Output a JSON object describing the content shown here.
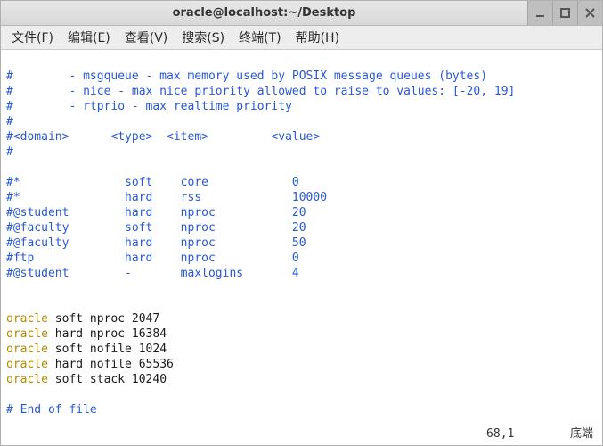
{
  "titlebar": {
    "title": "oracle@localhost:~/Desktop"
  },
  "menubar": {
    "file": "文件(F)",
    "edit": "编辑(E)",
    "view": "查看(V)",
    "search": "搜索(S)",
    "terminal": "终端(T)",
    "help": "帮助(H)"
  },
  "content": {
    "l01": "#        - msgqueue - max memory used by POSIX message queues (bytes)",
    "l02": "#        - nice - max nice priority allowed to raise to values: [-20, 19]",
    "l03": "#        - rtprio - max realtime priority",
    "l04": "#",
    "l05": "#<domain>      <type>  <item>         <value>",
    "l06": "#",
    "l07": "",
    "l08": "#*               soft    core            0",
    "l09": "#*               hard    rss             10000",
    "l10": "#@student        hard    nproc           20",
    "l11": "#@faculty        soft    nproc           20",
    "l12": "#@faculty        hard    nproc           50",
    "l13": "#ftp             hard    nproc           0",
    "l14": "#@student        -       maxlogins       4",
    "l15": "",
    "l16": "",
    "l17a": "oracle",
    "l17b": " soft nproc 2047",
    "l18a": "oracle",
    "l18b": " hard nproc 16384",
    "l19a": "oracle",
    "l19b": " soft nofile 1024",
    "l20a": "oracle",
    "l20b": " hard nofile 65536",
    "l21a": "oracle",
    "l21b": " soft stack 10240",
    "l22": "",
    "l23": "# End of file"
  },
  "status": {
    "pos": "68,1",
    "label": "底端"
  }
}
